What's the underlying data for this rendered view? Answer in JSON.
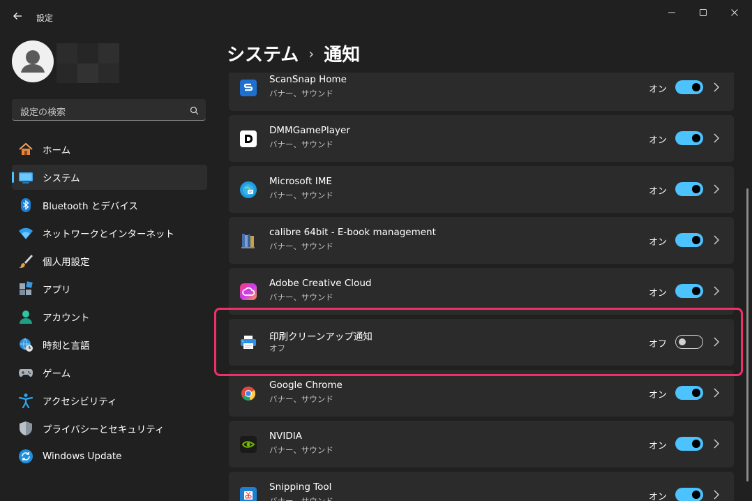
{
  "window": {
    "title": "設定"
  },
  "profile": {
    "name": ""
  },
  "search": {
    "placeholder": "設定の検索"
  },
  "sidebar": {
    "items": [
      {
        "label": "ホーム",
        "icon": "home-icon"
      },
      {
        "label": "システム",
        "icon": "system-icon",
        "active": true
      },
      {
        "label": "Bluetooth とデバイス",
        "icon": "bluetooth-icon"
      },
      {
        "label": "ネットワークとインターネット",
        "icon": "wifi-icon"
      },
      {
        "label": "個人用設定",
        "icon": "brush-icon"
      },
      {
        "label": "アプリ",
        "icon": "apps-icon"
      },
      {
        "label": "アカウント",
        "icon": "account-icon"
      },
      {
        "label": "時刻と言語",
        "icon": "globe-clock-icon"
      },
      {
        "label": "ゲーム",
        "icon": "gamepad-icon"
      },
      {
        "label": "アクセシビリティ",
        "icon": "accessibility-icon"
      },
      {
        "label": "プライバシーとセキュリティ",
        "icon": "shield-icon"
      },
      {
        "label": "Windows Update",
        "icon": "update-icon"
      }
    ]
  },
  "header": {
    "parent": "システム",
    "separator": "›",
    "current": "通知"
  },
  "apps": [
    {
      "name": "ScanSnap Home",
      "sub": "バナー、サウンド",
      "state": "オン",
      "on": true,
      "icon": "scansnap-icon"
    },
    {
      "name": "DMMGamePlayer",
      "sub": "バナー、サウンド",
      "state": "オン",
      "on": true,
      "icon": "dmm-icon"
    },
    {
      "name": "Microsoft IME",
      "sub": "バナー、サウンド",
      "state": "オン",
      "on": true,
      "icon": "ime-icon"
    },
    {
      "name": "calibre 64bit - E-book management",
      "sub": "バナー、サウンド",
      "state": "オン",
      "on": true,
      "icon": "calibre-icon"
    },
    {
      "name": "Adobe Creative Cloud",
      "sub": "バナー、サウンド",
      "state": "オン",
      "on": true,
      "icon": "creative-cloud-icon"
    },
    {
      "name": "印刷クリーンアップ通知",
      "sub": "オフ",
      "state": "オフ",
      "on": false,
      "icon": "printer-icon"
    },
    {
      "name": "Google Chrome",
      "sub": "バナー、サウンド",
      "state": "オン",
      "on": true,
      "icon": "chrome-icon"
    },
    {
      "name": "NVIDIA",
      "sub": "バナー、サウンド",
      "state": "オン",
      "on": true,
      "icon": "nvidia-icon"
    },
    {
      "name": "Snipping Tool",
      "sub": "バナー、サウンド",
      "state": "オン",
      "on": true,
      "icon": "snipping-tool-icon"
    }
  ],
  "colors": {
    "accent": "#4cc2ff",
    "highlight": "#f0306a",
    "background": "#202020",
    "card": "#2b2b2b"
  }
}
